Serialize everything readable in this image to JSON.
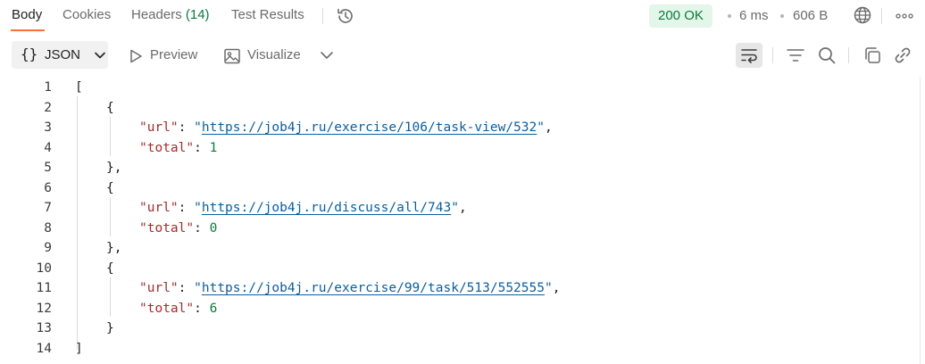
{
  "tabs": [
    {
      "label": "Body",
      "active": true
    },
    {
      "label": "Cookies"
    },
    {
      "label": "Headers",
      "count": "(14)"
    },
    {
      "label": "Test Results"
    }
  ],
  "status": {
    "code": "200 OK",
    "time": "6 ms",
    "size": "606 B"
  },
  "toolbar": {
    "format_label": "JSON",
    "format_icon": "{}",
    "preview_label": "Preview",
    "visualize_label": "Visualize"
  },
  "icons": [
    "history-icon",
    "globe-icon",
    "more-icon",
    "wrap-lines-icon",
    "filter-icon",
    "search-icon",
    "copy-icon",
    "link-icon"
  ],
  "colors": {
    "accent": "#ff6c37",
    "status_bg": "#e3f6e9",
    "status_fg": "#0b7b3e",
    "key": "#a32c2c",
    "string": "#0b5f9e",
    "number": "#0b7b3e"
  },
  "response": {
    "line_numbers": [
      "1",
      "2",
      "3",
      "4",
      "5",
      "6",
      "7",
      "8",
      "9",
      "10",
      "11",
      "12",
      "13",
      "14"
    ],
    "items": [
      {
        "url": "https://job4j.ru/exercise/106/task-view/532",
        "total": "1"
      },
      {
        "url": "https://job4j.ru/discuss/all/743",
        "total": "0"
      },
      {
        "url": "https://job4j.ru/exercise/99/task/513/552555",
        "total": "6"
      }
    ],
    "key_url": "\"url\"",
    "key_total": "\"total\""
  }
}
